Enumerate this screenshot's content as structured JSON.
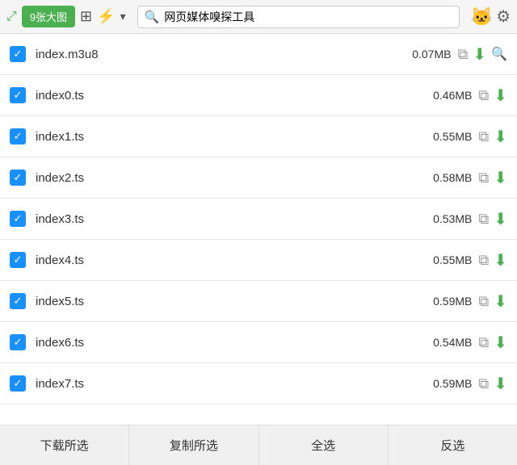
{
  "toolbar": {
    "photos_count": "9张大图",
    "search_placeholder": "网页媒体嗅探工具",
    "search_value": "网页媒体嗅探工具"
  },
  "files": [
    {
      "name": "index.m3u8",
      "size": "0.07MB",
      "has_search": true
    },
    {
      "name": "index0.ts",
      "size": "0.46MB",
      "has_search": false
    },
    {
      "name": "index1.ts",
      "size": "0.55MB",
      "has_search": false
    },
    {
      "name": "index2.ts",
      "size": "0.58MB",
      "has_search": false
    },
    {
      "name": "index3.ts",
      "size": "0.53MB",
      "has_search": false
    },
    {
      "name": "index4.ts",
      "size": "0.55MB",
      "has_search": false
    },
    {
      "name": "index5.ts",
      "size": "0.59MB",
      "has_search": false
    },
    {
      "name": "index6.ts",
      "size": "0.54MB",
      "has_search": false
    },
    {
      "name": "index7.ts",
      "size": "0.59MB",
      "has_search": false
    }
  ],
  "bottom_buttons": {
    "download": "下载所选",
    "copy": "复制所选",
    "select_all": "全选",
    "deselect": "反选"
  }
}
